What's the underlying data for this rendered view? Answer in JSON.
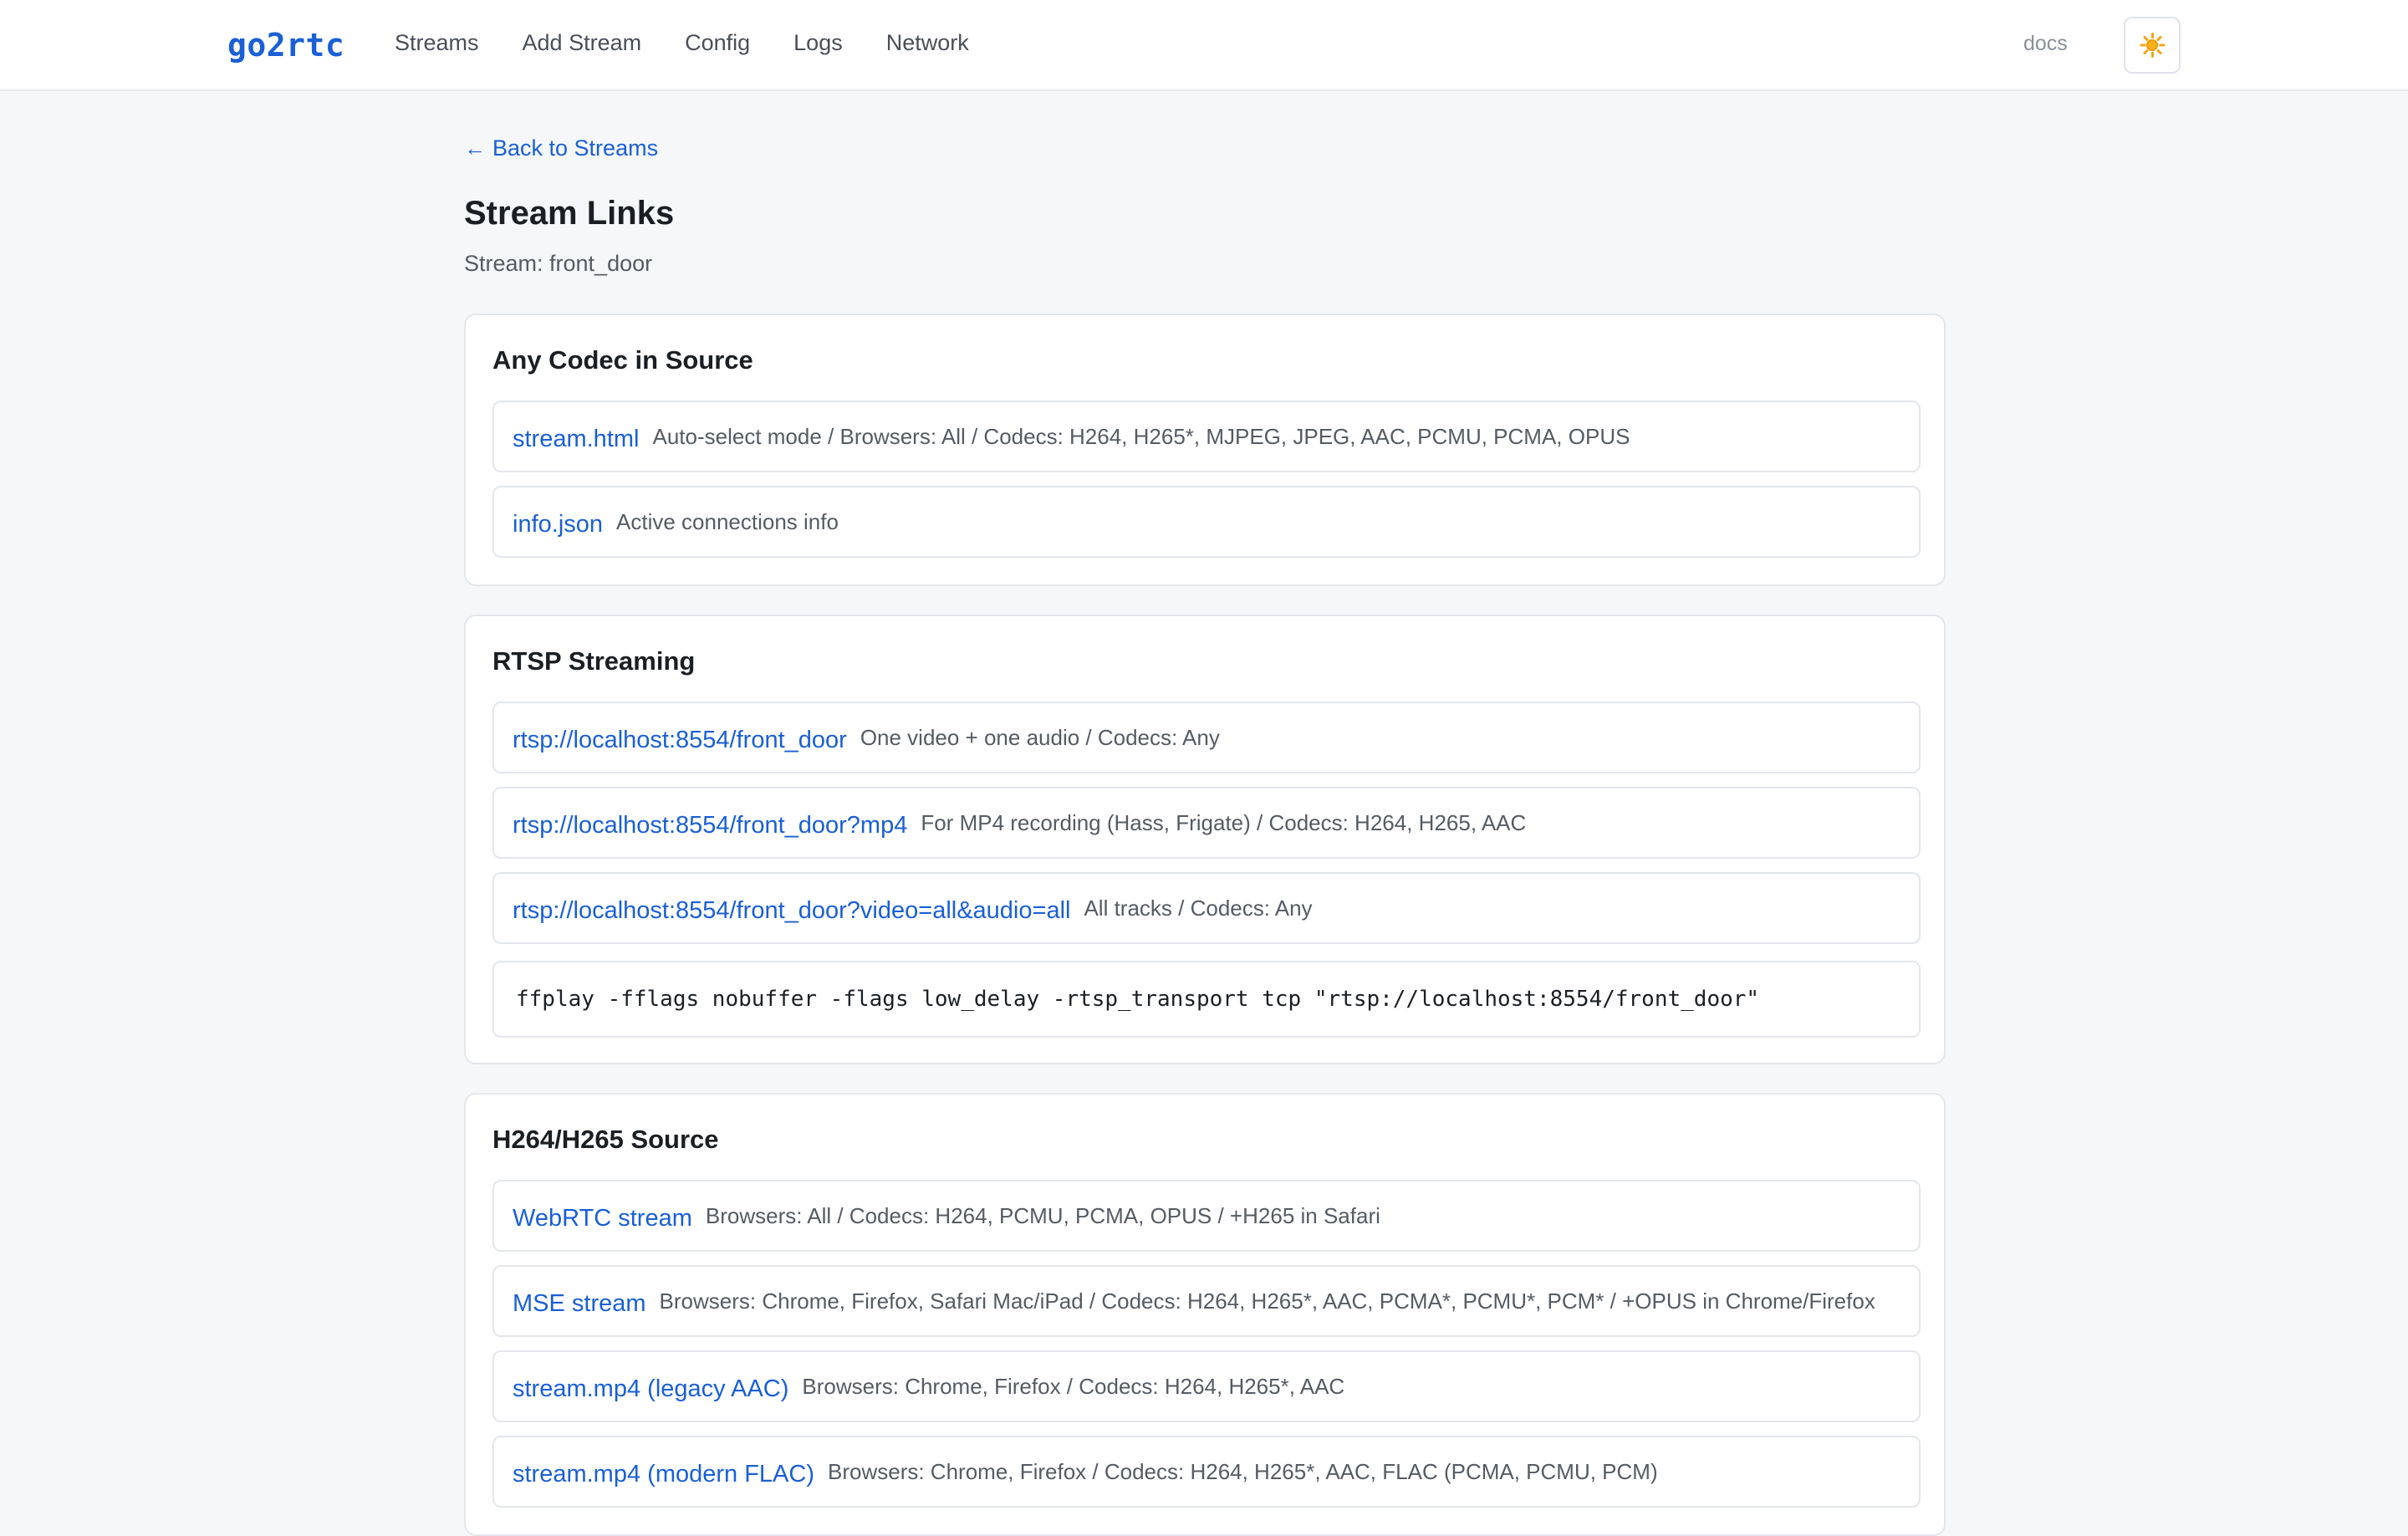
{
  "app": {
    "logo": "go2rtc",
    "nav": [
      "Streams",
      "Add Stream",
      "Config",
      "Logs",
      "Network"
    ],
    "docs_label": "docs",
    "theme_icon": "sun-icon"
  },
  "page": {
    "back_label": "Back to Streams",
    "back_arrow": "←",
    "title": "Stream Links",
    "subtitle": "Stream: front_door"
  },
  "sections": [
    {
      "title": "Any Codec in Source",
      "links": [
        {
          "label": "stream.html",
          "desc": "Auto-select mode / Browsers: All / Codecs: H264, H265*, MJPEG, JPEG, AAC, PCMU, PCMA, OPUS"
        },
        {
          "label": "info.json",
          "desc": "Active connections info"
        }
      ]
    },
    {
      "title": "RTSP Streaming",
      "links": [
        {
          "label": "rtsp://localhost:8554/front_door",
          "desc": "One video + one audio / Codecs: Any"
        },
        {
          "label": "rtsp://localhost:8554/front_door?mp4",
          "desc": "For MP4 recording (Hass, Frigate) / Codecs: H264, H265, AAC"
        },
        {
          "label": "rtsp://localhost:8554/front_door?video=all&audio=all",
          "desc": "All tracks / Codecs: Any"
        }
      ],
      "command": "ffplay -fflags nobuffer -flags low_delay -rtsp_transport tcp \"rtsp://localhost:8554/front_door\""
    },
    {
      "title": "H264/H265 Source",
      "links": [
        {
          "label": "WebRTC stream",
          "desc": "Browsers: All / Codecs: H264, PCMU, PCMA, OPUS / +H265 in Safari"
        },
        {
          "label": "MSE stream",
          "desc": "Browsers: Chrome, Firefox, Safari Mac/iPad / Codecs: H264, H265*, AAC, PCMA*, PCMU*, PCM* / +OPUS in Chrome/Firefox"
        },
        {
          "label": "stream.mp4 (legacy AAC)",
          "desc": "Browsers: Chrome, Firefox / Codecs: H264, H265*, AAC"
        },
        {
          "label": "stream.mp4 (modern FLAC)",
          "desc": "Browsers: Chrome, Firefox / Codecs: H264, H265*, AAC, FLAC (PCMA, PCMU, PCM)"
        }
      ]
    }
  ]
}
